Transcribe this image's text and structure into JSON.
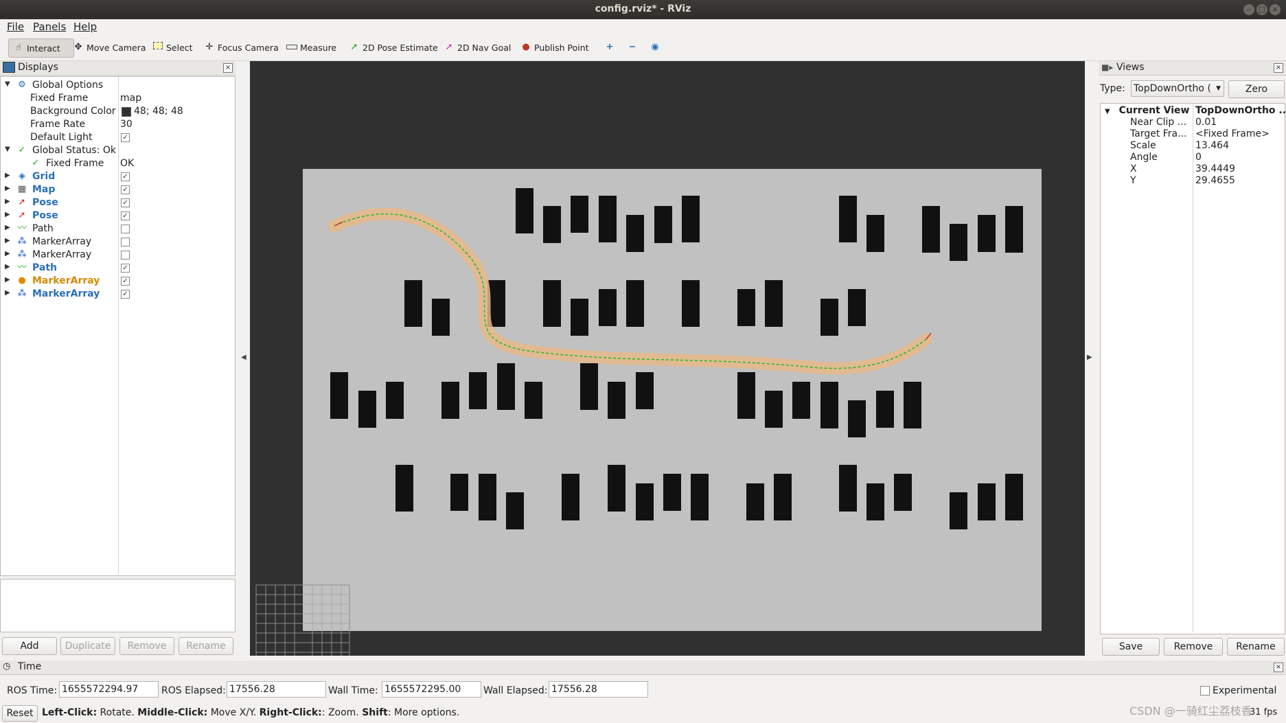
{
  "window": {
    "title": "config.rviz* - RViz"
  },
  "menu": {
    "file": "File",
    "panels": "Panels",
    "help": "Help"
  },
  "toolbar": {
    "interact": "Interact",
    "move_camera": "Move Camera",
    "select": "Select",
    "focus_camera": "Focus Camera",
    "measure": "Measure",
    "pose_estimate": "2D Pose Estimate",
    "nav_goal": "2D Nav Goal",
    "publish_point": "Publish Point"
  },
  "displays": {
    "title": "Displays",
    "rows": [
      {
        "label": "Global Options",
        "value": ""
      },
      {
        "label": "Fixed Frame",
        "value": "map"
      },
      {
        "label": "Background Color",
        "value": "48; 48; 48"
      },
      {
        "label": "Frame Rate",
        "value": "30"
      },
      {
        "label": "Default Light",
        "value": ""
      },
      {
        "label": "Global Status: Ok",
        "value": ""
      },
      {
        "label": "Fixed Frame",
        "value": "OK"
      },
      {
        "label": "Grid",
        "value": ""
      },
      {
        "label": "Map",
        "value": ""
      },
      {
        "label": "Pose",
        "value": ""
      },
      {
        "label": "Pose",
        "value": ""
      },
      {
        "label": "Path",
        "value": ""
      },
      {
        "label": "MarkerArray",
        "value": ""
      },
      {
        "label": "MarkerArray",
        "value": ""
      },
      {
        "label": "Path",
        "value": ""
      },
      {
        "label": "MarkerArray",
        "value": ""
      },
      {
        "label": "MarkerArray",
        "value": ""
      }
    ],
    "buttons": {
      "add": "Add",
      "duplicate": "Duplicate",
      "remove": "Remove",
      "rename": "Rename"
    }
  },
  "views": {
    "title": "Views",
    "type_label": "Type:",
    "type_value": "TopDownOrtho (",
    "zero": "Zero",
    "current_view": {
      "label": "Current View",
      "value": "TopDownOrtho ..."
    },
    "props": [
      {
        "label": "Near Clip ...",
        "value": "0.01"
      },
      {
        "label": "Target Fra...",
        "value": "<Fixed Frame>"
      },
      {
        "label": "Scale",
        "value": "13.464"
      },
      {
        "label": "Angle",
        "value": "0"
      },
      {
        "label": "X",
        "value": "39.4449"
      },
      {
        "label": "Y",
        "value": "29.4655"
      }
    ],
    "buttons": {
      "save": "Save",
      "remove": "Remove",
      "rename": "Rename"
    }
  },
  "time": {
    "title": "Time",
    "ros_time_label": "ROS Time:",
    "ros_time": "1655572294.97",
    "ros_elapsed_label": "ROS Elapsed:",
    "ros_elapsed": "17556.28",
    "wall_time_label": "Wall Time:",
    "wall_time": "1655572295.00",
    "wall_elapsed_label": "Wall Elapsed:",
    "wall_elapsed": "17556.28",
    "experimental": "Experimental"
  },
  "status": {
    "reset": "Reset",
    "left_b": "Left-Click:",
    "left_t": " Rotate. ",
    "mid_b": "Middle-Click:",
    "mid_t": " Move X/Y. ",
    "right_b": "Right-Click:",
    "right_t": ": Zoom. ",
    "shift_b": "Shift",
    "shift_t": ": More options.",
    "fps": "31 fps",
    "watermark": "CSDN @一骑红尘荔枝香"
  }
}
